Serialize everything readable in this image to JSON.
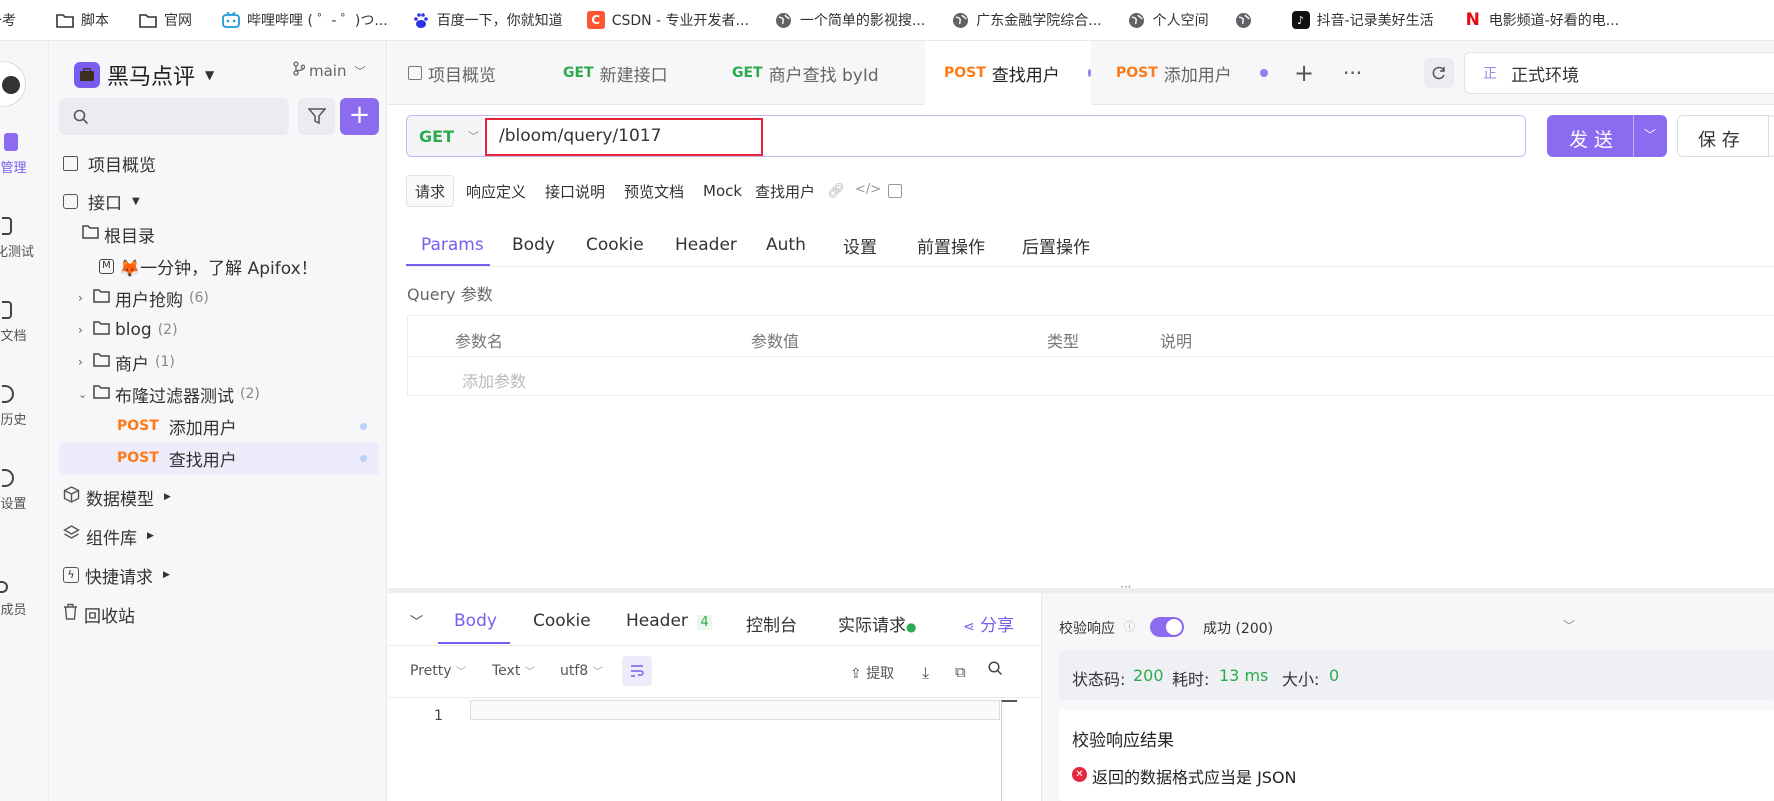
{
  "bookmarks": [
    {
      "icon": "page-icon",
      "label": "备考"
    },
    {
      "icon": "folder-icon",
      "label": "脚本"
    },
    {
      "icon": "folder-icon",
      "label": "官网"
    },
    {
      "icon": "bilibili-icon",
      "label": "哔哩哔哩 ( ゜- ゜)つ..."
    },
    {
      "icon": "baidu-icon",
      "label": "百度一下，你就知道"
    },
    {
      "icon": "csdn-icon",
      "label": "CSDN - 专业开发者..."
    },
    {
      "icon": "globe-icon",
      "label": "一个简单的影视搜..."
    },
    {
      "icon": "globe-icon",
      "label": "广东金融学院综合..."
    },
    {
      "icon": "globe-icon",
      "label": "个人空间"
    },
    {
      "icon": "globe-icon",
      "label": ""
    },
    {
      "icon": "tiktok-icon",
      "label": "抖音-记录美好生活"
    },
    {
      "icon": "netflix-icon",
      "label": "电影频道-好看的电..."
    }
  ],
  "rail": [
    {
      "label": "管理"
    },
    {
      "label": "化测试"
    },
    {
      "label": "文档"
    },
    {
      "label": "历史"
    },
    {
      "label": "设置"
    },
    {
      "label": "成员"
    }
  ],
  "project": {
    "name": "黑马点评",
    "branch": "main"
  },
  "sidebar": {
    "overview": "项目概览",
    "api": "接口",
    "root": "根目录",
    "intro": "🦊一分钟，了解 Apifox！",
    "folders": [
      {
        "name": "用户抢购",
        "count": "(6)"
      },
      {
        "name": "blog",
        "count": "(2)"
      },
      {
        "name": "商户",
        "count": "(1)"
      },
      {
        "name": "布隆过滤器测试",
        "count": "(2)"
      }
    ],
    "endpoints": [
      {
        "method": "POST",
        "name": "添加用户"
      },
      {
        "method": "POST",
        "name": "查找用户"
      }
    ],
    "bottom": [
      "数据模型",
      "组件库",
      "快捷请求",
      "回收站"
    ]
  },
  "tabs": [
    {
      "method": "",
      "label": "项目概览"
    },
    {
      "method": "GET",
      "label": "新建接口"
    },
    {
      "method": "GET",
      "label": "商户查找 byId"
    },
    {
      "method": "POST",
      "label": "查找用户"
    },
    {
      "method": "POST",
      "label": "添加用户"
    }
  ],
  "env": {
    "badge": "正",
    "label": "正式环境"
  },
  "request": {
    "method": "GET",
    "url": "/bloom/query/1017",
    "send": "发 送",
    "save": "保 存"
  },
  "subtabs": [
    "请求",
    "响应定义",
    "接口说明",
    "预览文档",
    "Mock",
    "查找用户"
  ],
  "paramTabs": [
    "Params",
    "Body",
    "Cookie",
    "Header",
    "Auth",
    "设置",
    "前置操作",
    "后置操作"
  ],
  "query": {
    "title": "Query 参数",
    "headers": [
      "参数名",
      "参数值",
      "类型",
      "说明"
    ],
    "addPlaceholder": "添加参数"
  },
  "response": {
    "tabs": [
      "Body",
      "Cookie",
      "Header",
      "控制台",
      "实际请求"
    ],
    "headerCount": "4",
    "share": "分享",
    "pretty": "Pretty",
    "text": "Text",
    "encoding": "utf8",
    "extract": "提取",
    "lineNo": "1",
    "validate": "校验响应",
    "successLabel": "成功 (200)",
    "statusLabel": "状态码:",
    "status": "200",
    "timeLabel": "耗时:",
    "time": "13 ms",
    "sizeLabel": "大小:",
    "size": "0",
    "resultTitle": "校验响应结果",
    "error": "返回的数据格式应当是 JSON"
  },
  "colors": {
    "accent": "#8b6cf0",
    "post": "#ff7a17",
    "get": "#2bab4d",
    "error": "#e5263b"
  }
}
